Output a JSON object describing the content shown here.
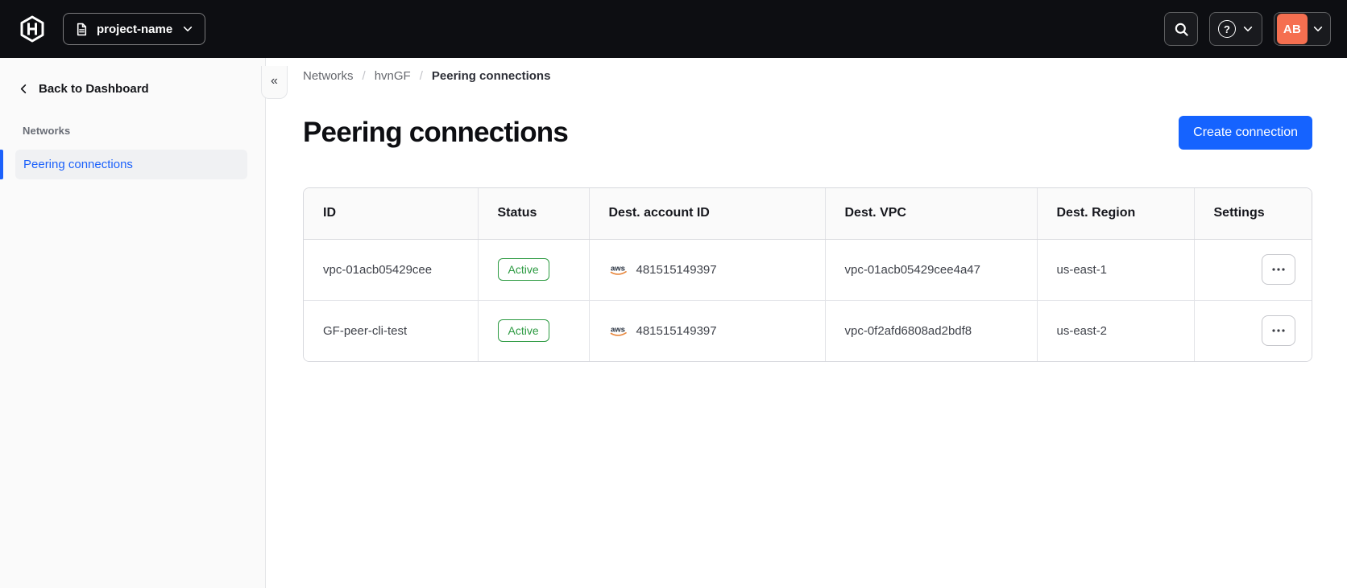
{
  "nav": {
    "project_switcher_label": "project-name",
    "avatar_initials": "AB",
    "help_glyph": "?"
  },
  "sidebar": {
    "back_label": "Back to Dashboard",
    "section_label": "Networks",
    "items": [
      {
        "label": "Peering connections",
        "active": true
      }
    ],
    "collapse_glyph": "«"
  },
  "breadcrumb": {
    "items": [
      "Networks",
      "hvnGF",
      "Peering connections"
    ],
    "separator": "/"
  },
  "page": {
    "title": "Peering connections",
    "create_button_label": "Create connection"
  },
  "table": {
    "columns": [
      "ID",
      "Status",
      "Dest. account ID",
      "Dest. VPC",
      "Dest. Region",
      "Settings"
    ],
    "rows": [
      {
        "id": "vpc-01acb05429cee",
        "status": "Active",
        "provider": "aws",
        "dest_account_id": "481515149397",
        "dest_vpc": "vpc-01acb05429cee4a47",
        "dest_region": "us-east-1"
      },
      {
        "id": "GF-peer-cli-test",
        "status": "Active",
        "provider": "aws",
        "dest_account_id": "481515149397",
        "dest_vpc": "vpc-0f2afd6808ad2bdf8",
        "dest_region": "us-east-2"
      }
    ]
  },
  "icons": {
    "logo": "hashicorp-logo",
    "project": "document-icon",
    "search": "search-icon",
    "help": "help-icon",
    "chevron_down": "chevron-down-icon",
    "chevron_left": "chevron-left-icon",
    "collapse": "collapse-sidebar-icon",
    "provider": "aws-icon",
    "row_menu": "ellipsis-icon"
  },
  "colors": {
    "nav_bg": "#0d0e12",
    "accent_blue": "#1563ff",
    "active_link_blue": "#1c61fb",
    "success_green": "#2c9a41",
    "avatar_orange": "#f56f50",
    "sidebar_bg": "#fafafa",
    "breadcrumb_gray": "#65676d"
  }
}
